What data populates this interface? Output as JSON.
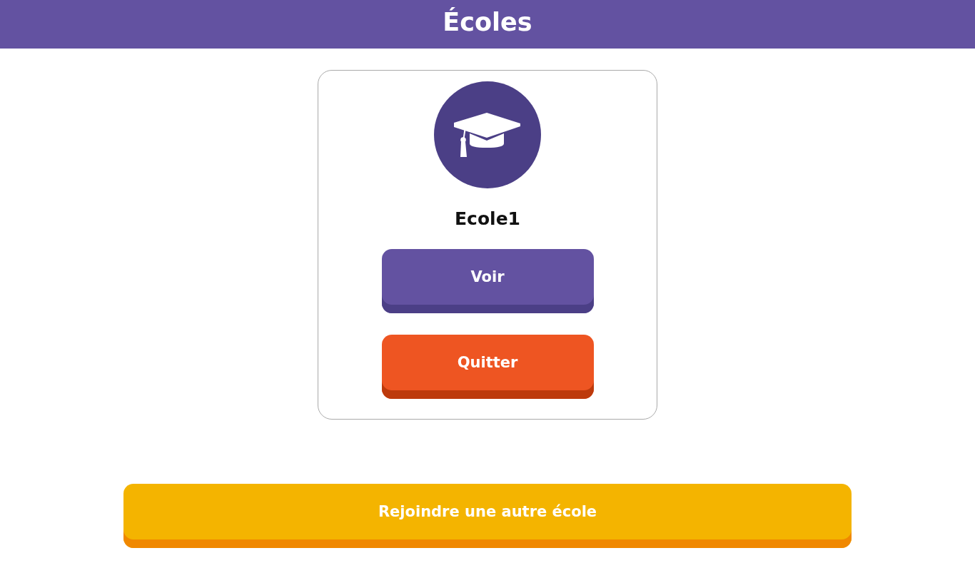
{
  "header": {
    "title": "Écoles"
  },
  "schools": [
    {
      "name": "Ecole1",
      "actions": [
        {
          "label": "Voir",
          "kind": "view"
        },
        {
          "label": "Quitter",
          "kind": "leave"
        }
      ]
    }
  ],
  "join_button": {
    "label": "Rejoindre une autre école"
  }
}
